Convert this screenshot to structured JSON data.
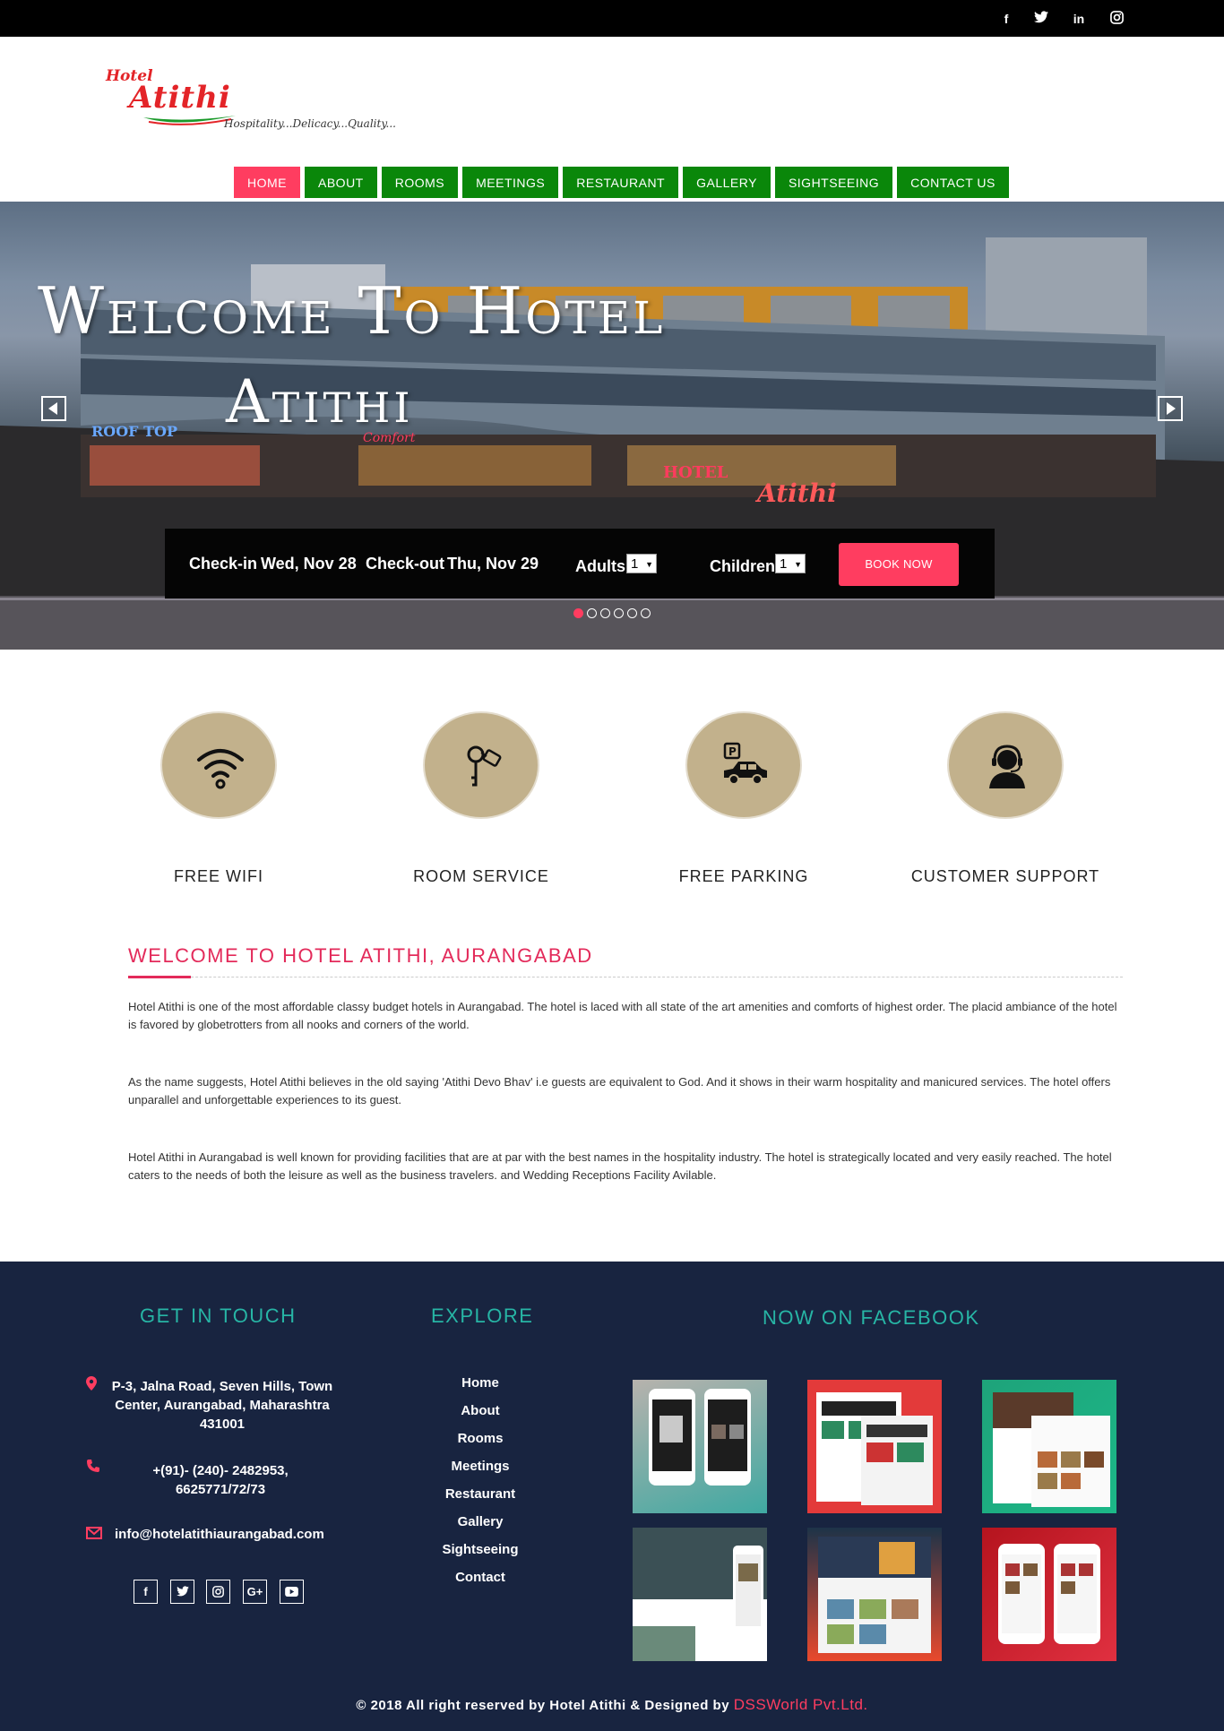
{
  "topbar": {
    "social": [
      "f",
      "t",
      "in",
      "ig"
    ]
  },
  "logo": {
    "hotel": "Hotel",
    "name": "Atithi",
    "tagline": "Hospitality...Delicacy...Quality..."
  },
  "nav": {
    "items": [
      "HOME",
      "ABOUT",
      "ROOMS",
      "MEETINGS",
      "RESTAURANT",
      "GALLERY",
      "SIGHTSEEING",
      "CONTACT US"
    ],
    "active": "HOME"
  },
  "hero": {
    "title_line1": "Welcome To Hotel",
    "title_line2": "Atithi",
    "prev_icon": "chevron-left-icon",
    "next_icon": "chevron-right-icon",
    "slide_count": 6,
    "active_slide": 1
  },
  "booking": {
    "checkin_label": "Check-in",
    "checkin_date": "Wed, Nov 28",
    "checkout_label": "Check-out",
    "checkout_date": "Thu, Nov 29",
    "adults_label": "Adults",
    "adults_value": "1",
    "children_label": "Children",
    "children_value": "1",
    "book_label": "BOOK NOW"
  },
  "amenities": [
    {
      "label": "FREE WIFI",
      "icon": "wifi-icon"
    },
    {
      "label": "ROOM SERVICE",
      "icon": "key-icon"
    },
    {
      "label": "FREE PARKING",
      "icon": "parking-car-icon"
    },
    {
      "label": "CUSTOMER SUPPORT",
      "icon": "headset-support-icon"
    }
  ],
  "welcome": {
    "heading": "WELCOME TO HOTEL ATITHI, AURANGABAD",
    "paragraphs": [
      "Hotel Atithi is one of the most affordable classy budget hotels in Aurangabad. The hotel is laced with all state of the art amenities and comforts of highest order. The placid ambiance of the hotel is favored by globetrotters from all nooks and corners of the world.",
      "As the name suggests, Hotel Atithi believes in the old saying 'Atithi Devo Bhav' i.e guests are equivalent to God. And it shows in their warm hospitality and manicured services. The hotel offers unparallel and unforgettable experiences to its guest.",
      "Hotel Atithi in Aurangabad is well known for providing facilities that are at par with the best names in the hospitality industry. The hotel is strategically located and very easily reached. The hotel caters to the needs of both the leisure as well as the business travelers. and Wedding Receptions Facility Avilable."
    ]
  },
  "footer": {
    "contact_heading": "GET IN TOUCH",
    "address": "P-3, Jalna Road, Seven Hills, Town Center, Aurangabad, Maharashtra 431001",
    "phone": "+(91)- (240)- 2482953, 6625771/72/73",
    "email": "info@hotelatithiaurangabad.com",
    "social": [
      "f",
      "t",
      "ig",
      "G+",
      "yt"
    ],
    "explore_heading": "EXPLORE",
    "explore_links": [
      "Home",
      "About",
      "Rooms",
      "Meetings",
      "Restaurant",
      "Gallery",
      "Sightseeing",
      "Contact"
    ],
    "facebook_heading": "NOW ON FACEBOOK",
    "copyright": "© 2018 All right reserved by Hotel Atithi & Designed by",
    "designer": "DSSWorld Pvt.Ltd."
  },
  "colors": {
    "nav_green": "#0a870a",
    "accent_pink": "#ff3d60",
    "heading_red": "#e32a5a",
    "footer_bg": "#182440",
    "footer_heading": "#27b5a5",
    "amenity_circle": "#c2b18c"
  }
}
